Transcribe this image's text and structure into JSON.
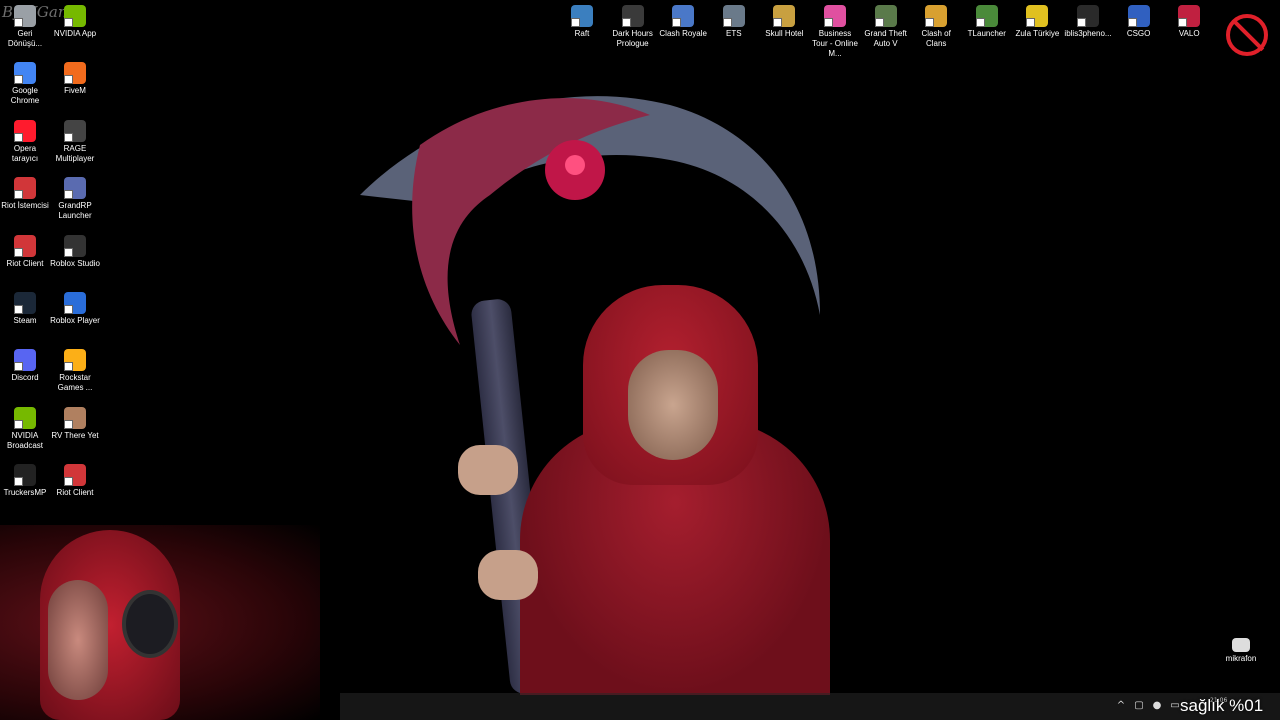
{
  "watermark": "ByWGame",
  "left_icons": [
    {
      "label": "Geri Dönüşü...",
      "name": "recycle-bin",
      "color": "#9aa0a6"
    },
    {
      "label": "NVIDIA App",
      "name": "nvidia-app",
      "color": "#76b900"
    },
    {
      "label": "Google Chrome",
      "name": "google-chrome",
      "color": "#4285f4"
    },
    {
      "label": "FiveM",
      "name": "fivem",
      "color": "#f26b1d"
    },
    {
      "label": "Opera tarayıcı",
      "name": "opera",
      "color": "#ff1b2d"
    },
    {
      "label": "RAGE Multiplayer",
      "name": "rage-multiplayer",
      "color": "#444444"
    },
    {
      "label": "Riot İstemcisi",
      "name": "riot-client-1",
      "color": "#d13639"
    },
    {
      "label": "GrandRP Launcher",
      "name": "grandrp-launcher",
      "color": "#5a6bb0"
    },
    {
      "label": "Riot Client",
      "name": "riot-client-2",
      "color": "#d13639"
    },
    {
      "label": "Roblox Studio",
      "name": "roblox-studio",
      "color": "#333333"
    },
    {
      "label": "Steam",
      "name": "steam",
      "color": "#1b2838"
    },
    {
      "label": "Roblox Player",
      "name": "roblox-player",
      "color": "#2a6dd9"
    },
    {
      "label": "Discord",
      "name": "discord",
      "color": "#5865f2"
    },
    {
      "label": "Rockstar Games ...",
      "name": "rockstar-games",
      "color": "#fcaf17"
    },
    {
      "label": "NVIDIA Broadcast",
      "name": "nvidia-broadcast",
      "color": "#76b900"
    },
    {
      "label": "RV There Yet",
      "name": "rv-there-yet",
      "color": "#b08060"
    },
    {
      "label": "TruckersMP",
      "name": "truckersmp",
      "color": "#222222"
    },
    {
      "label": "Riot Client",
      "name": "riot-client-3",
      "color": "#d13639"
    }
  ],
  "top_icons": [
    {
      "label": "Raft",
      "name": "raft",
      "color": "#3b7fbf"
    },
    {
      "label": "Dark Hours Prologue",
      "name": "dark-hours-prologue",
      "color": "#3a3a3a"
    },
    {
      "label": "Clash Royale",
      "name": "clash-royale",
      "color": "#4a78c8"
    },
    {
      "label": "ETS",
      "name": "ets",
      "color": "#6a7a8a"
    },
    {
      "label": "Skull Hotel",
      "name": "skull-hotel",
      "color": "#c8a040"
    },
    {
      "label": "Business Tour - Online M...",
      "name": "business-tour",
      "color": "#e050a0"
    },
    {
      "label": "Grand Theft Auto V",
      "name": "gta-v",
      "color": "#5a7a4a"
    },
    {
      "label": "Clash of Clans",
      "name": "clash-of-clans",
      "color": "#d8a030"
    },
    {
      "label": "TLauncher",
      "name": "tlauncher",
      "color": "#4a8a3a"
    },
    {
      "label": "Zula Türkiye",
      "name": "zula-turkiye",
      "color": "#e0c020"
    },
    {
      "label": "iblis3pheno...",
      "name": "iblis3pheno",
      "color": "#2a2a2a"
    },
    {
      "label": "CSGO",
      "name": "csgo",
      "color": "#3060c0"
    },
    {
      "label": "VALO",
      "name": "valo",
      "color": "#c02040"
    }
  ],
  "mikrafon": {
    "label": "mikrafon"
  },
  "overlay": {
    "text": "sağlık %01"
  },
  "tray": {
    "chevron": "^",
    "time": "21:06"
  }
}
